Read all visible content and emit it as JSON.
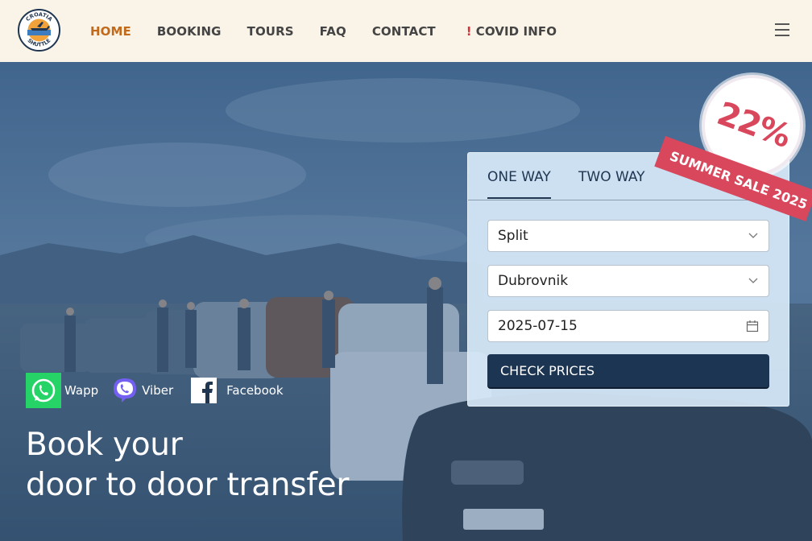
{
  "logo": {
    "top_text": "CROATIA",
    "bottom_text": "SHUTTLE"
  },
  "nav": {
    "items": [
      {
        "label": "HOME",
        "active": true
      },
      {
        "label": "BOOKING"
      },
      {
        "label": "TOURS"
      },
      {
        "label": "FAQ"
      },
      {
        "label": "CONTACT"
      }
    ],
    "covid_mark": "!",
    "covid_label": "COVID INFO",
    "menu_icon": "hamburger-icon"
  },
  "booking": {
    "tabs": [
      {
        "label": "ONE WAY",
        "active": true
      },
      {
        "label": "TWO WAY"
      }
    ],
    "from_value": "Split",
    "to_value": "Dubrovnik",
    "date_value": "2025-07-15",
    "submit_label": "CHECK PRICES"
  },
  "sale": {
    "percent": "22%",
    "label": "SUMMER SALE 2025"
  },
  "social": {
    "whatsapp": "Wapp",
    "viber": "Viber",
    "facebook": "Facebook"
  },
  "hero": {
    "headline_line1": "Book your",
    "headline_line2": "door to door transfer"
  },
  "colors": {
    "header_bg": "#faf3e7",
    "nav_active": "#c26a1c",
    "covid_mark": "#d4323b",
    "panel_bg": "#d6e8f8",
    "button_bg": "#1c3552",
    "sale_red": "#d9475c",
    "whatsapp_green": "#25d366",
    "viber_purple": "#7360f2"
  }
}
